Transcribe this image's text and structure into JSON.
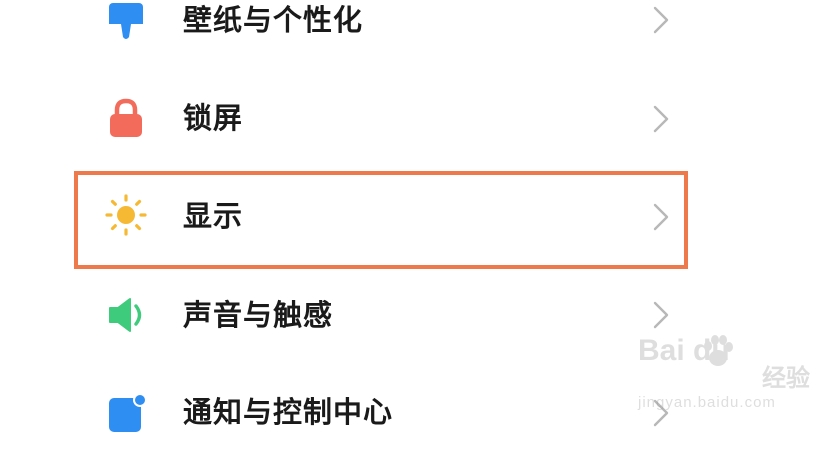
{
  "settings_list": {
    "items": [
      {
        "label": "壁纸与个性化",
        "icon": "paintbrush-icon",
        "icon_color": "#2f8ef2"
      },
      {
        "label": "锁屏",
        "icon": "lock-icon",
        "icon_color": "#f26b5b"
      },
      {
        "label": "显示",
        "icon": "sun-icon",
        "icon_color": "#f5b933",
        "highlighted": true
      },
      {
        "label": "声音与触感",
        "icon": "speaker-icon",
        "icon_color": "#3ecb7c"
      },
      {
        "label": "通知与控制中心",
        "icon": "notification-icon",
        "icon_color": "#2f8ef2"
      }
    ],
    "highlight_color": "#ee7a4c"
  },
  "watermark": {
    "brand": "Bai  du",
    "cn": "经验",
    "site": "jingyan.baidu.com"
  }
}
